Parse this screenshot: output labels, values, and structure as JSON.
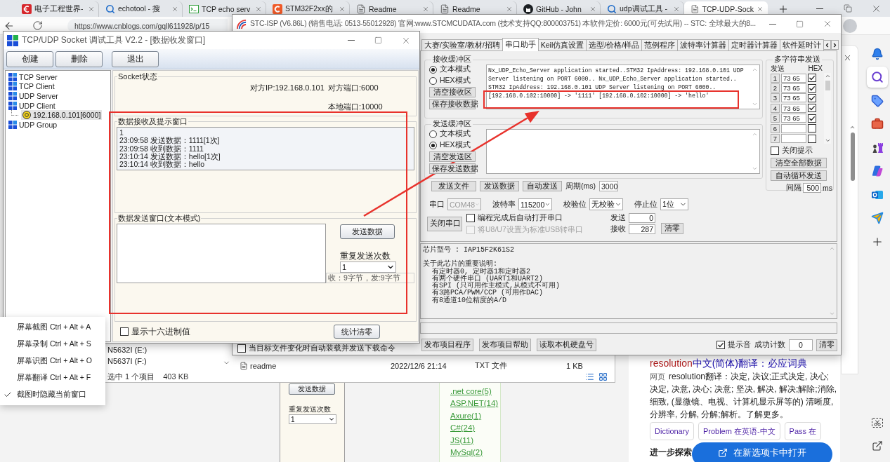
{
  "browser": {
    "tabs": [
      {
        "kind": "euro",
        "title": "电子工程世界-",
        "selected": false
      },
      {
        "kind": "search",
        "title": "echotool - 搜",
        "selected": false
      },
      {
        "kind": "terminal",
        "title": "TCP echo serv",
        "selected": false
      },
      {
        "kind": "logo",
        "title": "STM32F2xx的",
        "selected": false
      },
      {
        "kind": "page",
        "title": "Readme",
        "selected": false
      },
      {
        "kind": "page",
        "title": "Readme",
        "selected": false
      },
      {
        "kind": "github",
        "title": "GitHub - John",
        "selected": false
      },
      {
        "kind": "search",
        "title": "udp调试工具 -",
        "selected": false
      },
      {
        "kind": "page",
        "title": "TCP-UDP-Sock",
        "selected": true
      }
    ],
    "address": "https://www.cnblogs.com/gqll611928/p/15"
  },
  "edge_sidebar": {
    "top": [
      {
        "kind": "bell",
        "selected": false
      },
      {
        "kind": "search",
        "selected": true
      },
      {
        "kind": "tag",
        "selected": false
      },
      {
        "kind": "toolbox",
        "selected": false
      },
      {
        "kind": "chess",
        "selected": false
      },
      {
        "kind": "copilot",
        "selected": false
      },
      {
        "kind": "outlook",
        "selected": false
      },
      {
        "kind": "send",
        "selected": false
      },
      {
        "kind": "add",
        "selected": false
      }
    ],
    "bottom": [
      {
        "kind": "screenshot"
      },
      {
        "kind": "popout"
      }
    ]
  },
  "explorer": {
    "drives": [
      "N5632I (E:)",
      "N5637I (F:)"
    ],
    "file": {
      "name": "readme",
      "date": "2022/12/6 21:14",
      "type": "TXT 文件",
      "size": "1 KB"
    },
    "status": [
      "选中 1 个项目",
      "403 KB"
    ]
  },
  "blog": {
    "snapshot": {
      "button": "发送数据",
      "repeat_label": "重复发送次数",
      "repeat_value": "1"
    },
    "categories": [
      ".net core(5)",
      "ASP.NET(14)",
      "Axure(1)",
      "C#(24)",
      "JS(11)",
      "MySql(2)"
    ]
  },
  "translation": {
    "heading_word": "resolution",
    "heading_rest": "中文(简体)翻译：必应词典",
    "source": "网页",
    "text": "resolution翻译：决定, 决议;正式决定, 决心; 决定, 决意, 决心; 决意; 坚决, 解决, 解决;解除;消除, 细致, (显微镜、电视、计算机显示屏等的) 清晰度, 分辨率, 分解, 分解;解析。了解更多。",
    "chips": [
      "Dictionary",
      "Problem 在英语-中文",
      "Pass 在"
    ],
    "explore": "进一步探索",
    "open_button": "在新选项卡中打开"
  },
  "stc_window": {
    "title": "STC-ISP (V6.86L) (销售电话: 0513-55012928) 官网:www.STCMCUDATA.com (技术支持QQ:800003751) 本软件定价: 6000元(可先试用) -- STC: 全球最大的8...",
    "auto_load": {
      "label": "当目标文件变化时自动装载并发送下载命令",
      "checked": false
    },
    "tabs": [
      {
        "label": "大赛/实验室/教材/招聘",
        "selected": false
      },
      {
        "label": "串口助手",
        "selected": true
      },
      {
        "label": "Keil仿真设置",
        "selected": false
      },
      {
        "label": "选型/价格/样品",
        "selected": false
      },
      {
        "label": "范例程序",
        "selected": false
      },
      {
        "label": "波特率计算器",
        "selected": false
      },
      {
        "label": "定时器计算器",
        "selected": false
      },
      {
        "label": "软件延时计",
        "selected": false
      }
    ],
    "receive": {
      "title": "接收缓冲区",
      "modes": [
        {
          "label": "文本模式",
          "selected": true
        },
        {
          "label": "HEX模式",
          "selected": false
        }
      ],
      "buttons": [
        "清空接收区",
        "保存接收数据"
      ],
      "lines": [
        "Nx_UDP_Echo_Server application started..STM32 IpAddress: 192.168.0.101 UDP",
        "Server listening on PORT 6000.. Nx_UDP_Echo_Server application started..",
        "STM32 IpAddress: 192.168.0.101 UDP Server listening on PORT 6000..",
        "[192.168.0.102:10000] -> '1111' [192.168.0.102:10000] -> 'hello'"
      ]
    },
    "send": {
      "title": "发送缓冲区",
      "modes": [
        {
          "label": "文本模式",
          "selected": false
        },
        {
          "label": "HEX模式",
          "selected": true
        }
      ],
      "buttons": [
        "清空发送区",
        "保存发送数据"
      ]
    },
    "actions": [
      "发送文件",
      "发送数据",
      "自动发送"
    ],
    "period": {
      "label": "周期(ms)",
      "value": "3000"
    },
    "port_settings": [
      {
        "label": "串口",
        "value": "COM48",
        "disabled": true
      },
      {
        "label": "波特率",
        "value": "115200",
        "disabled": false
      },
      {
        "label": "校验位",
        "value": "无校验",
        "disabled": false
      },
      {
        "label": "停止位",
        "value": "1位",
        "disabled": false
      }
    ],
    "close_button": "关闭串口",
    "options": [
      {
        "label": "编程完成后自动打开串口",
        "checked": false,
        "disabled": false
      },
      {
        "label": "将U8/U7设置为标准USB转串口",
        "checked": false,
        "disabled": true
      }
    ],
    "counters": [
      {
        "label": "发送",
        "value": "0"
      },
      {
        "label": "接收",
        "value": "287"
      }
    ],
    "clear_button": "清零",
    "multi": {
      "title": "多字符串发送",
      "col_send": "发送",
      "col_hex": "HEX",
      "rows": [
        {
          "index": "1",
          "value": "73 65",
          "hex": true
        },
        {
          "index": "2",
          "value": "73 65",
          "hex": true
        },
        {
          "index": "3",
          "value": "73 65",
          "hex": true
        },
        {
          "index": "4",
          "value": "73 65",
          "hex": true
        },
        {
          "index": "5",
          "value": "73 65",
          "hex": true
        },
        {
          "index": "6",
          "hex": false
        },
        {
          "index": "7",
          "hex": false
        }
      ],
      "close_tips": {
        "label": "关闭提示",
        "checked": false
      },
      "buttons": [
        "清空全部数据",
        "自动循环发送"
      ],
      "interval": {
        "label": "间隔",
        "value": "500",
        "unit": "ms"
      }
    },
    "info": {
      "chip": "芯片型号 : IAP15F2K61S2",
      "heading": "关于此芯片的重要说明:",
      "notes": [
        "有定时器0, 定时器1和定时器2",
        "有两个硬件串口 (UART1和UART2)",
        "有SPI (只可用作主模式,从模式不可用)",
        "有3路PCA/PWM/CCP (可用作DAC)",
        "有8通道10位精度的A/D"
      ]
    },
    "footer": {
      "buttons": [
        "发布项目程序",
        "发布项目帮助",
        "读取本机硬盘号"
      ],
      "beep": {
        "label": "提示音",
        "checked": true
      },
      "count_label": "成功计数",
      "count_value": "0",
      "clear_button": "清零"
    }
  },
  "tcp_window": {
    "title": "TCP/UDP Socket 调试工具 V2.2 - [数据收发窗口]",
    "toolbar": [
      "创建",
      "删除",
      "退出"
    ],
    "tree": [
      {
        "label": "TCP Server",
        "selected": false
      },
      {
        "label": "TCP Client",
        "selected": false
      },
      {
        "label": "UDP Server",
        "selected": false
      },
      {
        "label": "UDP Client",
        "selected": false,
        "children": [
          {
            "label": "192.168.0.101[6000]",
            "selected": true
          }
        ]
      },
      {
        "label": "UDP Group",
        "selected": false
      }
    ],
    "socket_status": {
      "title": "Socket状态",
      "remote_ip": "对方IP:192.168.0.101",
      "remote_port": "对方端口:6000",
      "local_port": "本地端口:10000"
    },
    "receive": {
      "title": "数据接收及提示窗口",
      "lines": [
        "1",
        "23:09:58 发送数据：1111[1次]",
        "23:09:58 收到数据：1111",
        "23:10:14 发送数据：hello[1次]",
        "23:10:14 收到数据：hello"
      ]
    },
    "send": {
      "title": "数据发送窗口(文本模式)",
      "button": "发送数据",
      "repeat_label": "重复发送次数",
      "repeat_value": "1",
      "stats": "收：9字节，发:9字节"
    },
    "hex": {
      "label": "显示十六进制值",
      "checked": false
    },
    "reset_button": "统计清零"
  },
  "context_menu": [
    {
      "label": "屏幕截图 Ctrl + Alt + A",
      "checked": false
    },
    {
      "label": "屏幕录制 Ctrl + Alt + S",
      "checked": false
    },
    {
      "label": "屏幕识图 Ctrl + Alt + O",
      "checked": false
    },
    {
      "label": "屏幕翻译 Ctrl + Alt + F",
      "checked": false
    },
    {
      "label": "截图时隐藏当前窗口",
      "checked": true
    }
  ]
}
